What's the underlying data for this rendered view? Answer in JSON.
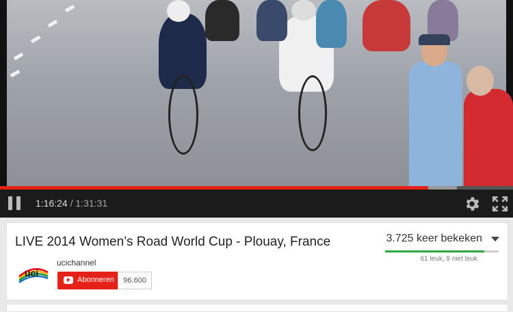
{
  "player": {
    "current_time": "1:16:24",
    "separator": "/",
    "duration": "1:31:31",
    "progress_fraction": 0.835,
    "buffered_fraction": 0.89
  },
  "video": {
    "title": "LIVE 2014 Women’s Road World Cup - Plouay, France",
    "views": "3.725 keer bekeken",
    "likes_text": "61 leuk, 9 niet leuk",
    "like_ratio": 0.871
  },
  "channel": {
    "name": "ucichannel",
    "subscribe_label": "Abonneren",
    "subscriber_count": "96.600",
    "logo_text": "uci"
  },
  "colors": {
    "accent_red": "#e62117",
    "like_green": "#2ba640"
  },
  "icons": [
    "pause-icon",
    "gear-icon",
    "fullscreen-icon",
    "chevron-down-icon",
    "youtube-icon"
  ]
}
